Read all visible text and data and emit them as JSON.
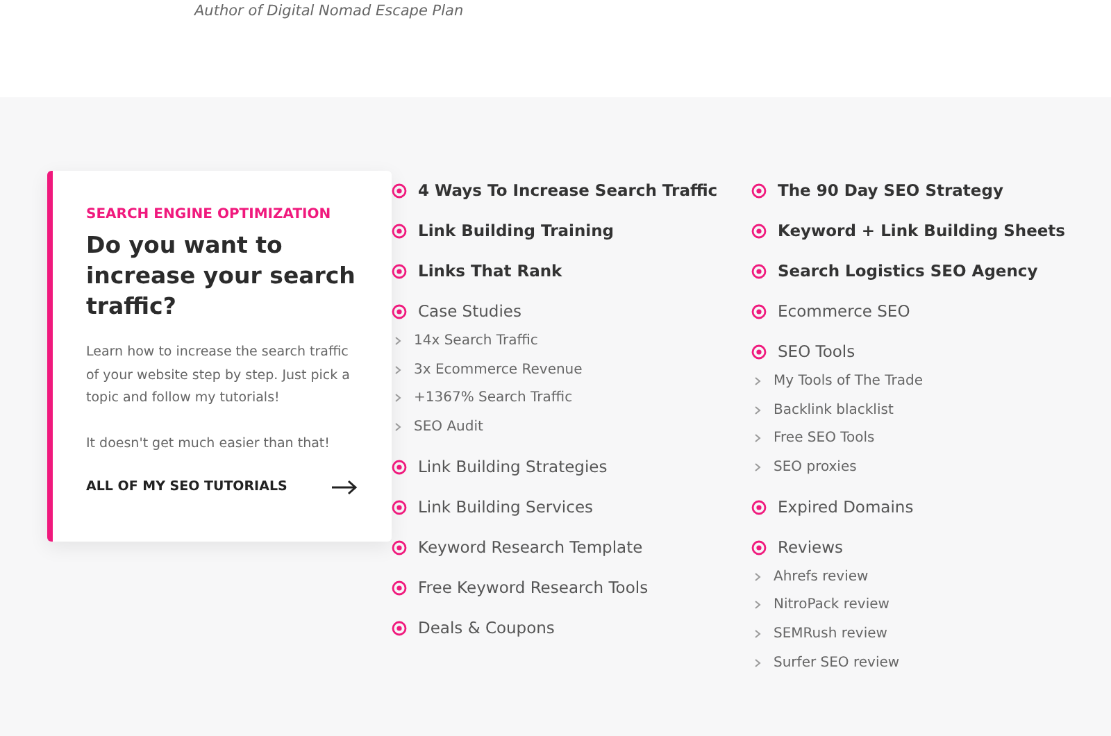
{
  "testimonial": {
    "byline": "Author of Digital Nomad Escape Plan"
  },
  "promo_card": {
    "eyebrow": "SEARCH ENGINE OPTIMIZATION",
    "heading": "Do you want to increase your search traffic?",
    "paragraphs": [
      "Learn how to increase the search traffic of your website step by step.  Just pick a topic and follow my tutorials!",
      "It doesn't get much easier than that!"
    ],
    "link": "ALL OF MY SEO TUTORIALS"
  },
  "topic_columns": [
    {
      "items": [
        {
          "label": "4 Ways To Increase Search Traffic",
          "kind": "featured"
        },
        {
          "label": "Link Building Training",
          "kind": "featured"
        },
        {
          "label": "Links That Rank",
          "kind": "featured"
        },
        {
          "label": "Case Studies",
          "kind": "topic",
          "children": [
            {
              "label": "14x Search Traffic"
            },
            {
              "label": "3x Ecommerce Revenue"
            },
            {
              "label": "+1367% Search Traffic"
            },
            {
              "label": "SEO Audit"
            }
          ]
        },
        {
          "label": "Link Building Strategies",
          "kind": "topic"
        },
        {
          "label": "Link Building Services",
          "kind": "topic"
        },
        {
          "label": "Keyword Research Template",
          "kind": "topic"
        },
        {
          "label": "Free Keyword Research Tools",
          "kind": "topic"
        },
        {
          "label": "Deals & Coupons",
          "kind": "topic"
        }
      ]
    },
    {
      "items": [
        {
          "label": "The 90 Day SEO Strategy",
          "kind": "featured"
        },
        {
          "label": "Keyword + Link Building Sheets",
          "kind": "featured"
        },
        {
          "label": "Search Logistics SEO Agency",
          "kind": "featured"
        },
        {
          "label": "Ecommerce SEO",
          "kind": "topic"
        },
        {
          "label": "SEO Tools",
          "kind": "topic",
          "children": [
            {
              "label": "My Tools of The Trade"
            },
            {
              "label": "Backlink blacklist"
            },
            {
              "label": "Free SEO Tools"
            },
            {
              "label": "SEO proxies"
            }
          ]
        },
        {
          "label": "Expired Domains",
          "kind": "topic"
        },
        {
          "label": "Reviews",
          "kind": "topic",
          "children": [
            {
              "label": "Ahrefs review"
            },
            {
              "label": "NitroPack review"
            },
            {
              "label": "SEMRush review"
            },
            {
              "label": "Surfer SEO review"
            }
          ]
        }
      ]
    }
  ]
}
